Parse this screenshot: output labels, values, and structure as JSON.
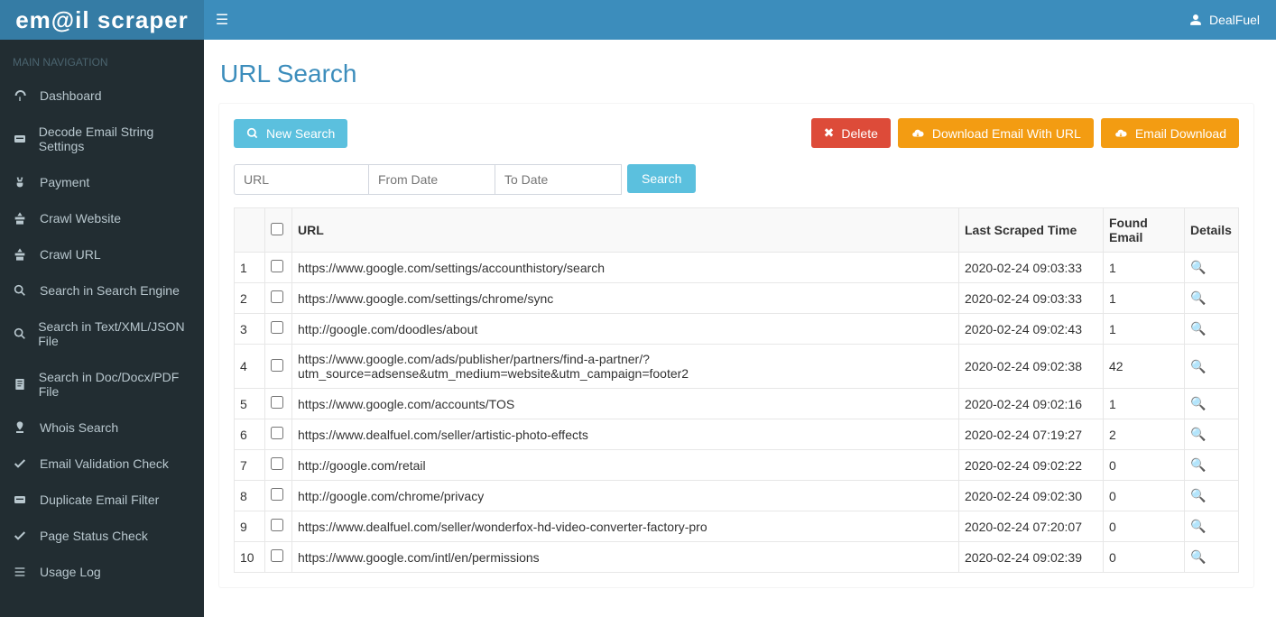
{
  "brand": "em@il scraper",
  "user_name": "DealFuel",
  "sidebar": {
    "header": "MAIN NAVIGATION",
    "items": [
      {
        "label": "Dashboard"
      },
      {
        "label": "Decode Email String Settings"
      },
      {
        "label": "Payment"
      },
      {
        "label": "Crawl Website"
      },
      {
        "label": "Crawl URL"
      },
      {
        "label": "Search in Search Engine"
      },
      {
        "label": "Search in Text/XML/JSON File"
      },
      {
        "label": "Search in Doc/Docx/PDF File"
      },
      {
        "label": "Whois Search"
      },
      {
        "label": "Email Validation Check"
      },
      {
        "label": "Duplicate Email Filter"
      },
      {
        "label": "Page Status Check"
      },
      {
        "label": "Usage Log"
      }
    ]
  },
  "page": {
    "title": "URL Search",
    "new_search_label": "New Search",
    "delete_label": "Delete",
    "download_with_url_label": "Download Email With URL",
    "email_download_label": "Email Download",
    "url_placeholder": "URL",
    "from_date_placeholder": "From Date",
    "to_date_placeholder": "To Date",
    "search_button_label": "Search"
  },
  "table": {
    "headers": {
      "url": "URL",
      "last_scraped": "Last Scraped Time",
      "found_email": "Found Email",
      "details": "Details"
    },
    "rows": [
      {
        "n": "1",
        "url": "https://www.google.com/settings/accounthistory/search",
        "time": "2020-02-24 09:03:33",
        "found": "1"
      },
      {
        "n": "2",
        "url": "https://www.google.com/settings/chrome/sync",
        "time": "2020-02-24 09:03:33",
        "found": "1"
      },
      {
        "n": "3",
        "url": "http://google.com/doodles/about",
        "time": "2020-02-24 09:02:43",
        "found": "1"
      },
      {
        "n": "4",
        "url": "https://www.google.com/ads/publisher/partners/find-a-partner/?utm_source=adsense&utm_medium=website&utm_campaign=footer2",
        "time": "2020-02-24 09:02:38",
        "found": "42"
      },
      {
        "n": "5",
        "url": "https://www.google.com/accounts/TOS",
        "time": "2020-02-24 09:02:16",
        "found": "1"
      },
      {
        "n": "6",
        "url": "https://www.dealfuel.com/seller/artistic-photo-effects",
        "time": "2020-02-24 07:19:27",
        "found": "2"
      },
      {
        "n": "7",
        "url": "http://google.com/retail",
        "time": "2020-02-24 09:02:22",
        "found": "0"
      },
      {
        "n": "8",
        "url": "http://google.com/chrome/privacy",
        "time": "2020-02-24 09:02:30",
        "found": "0"
      },
      {
        "n": "9",
        "url": "https://www.dealfuel.com/seller/wonderfox-hd-video-converter-factory-pro",
        "time": "2020-02-24 07:20:07",
        "found": "0"
      },
      {
        "n": "10",
        "url": "https://www.google.com/intl/en/permissions",
        "time": "2020-02-24 09:02:39",
        "found": "0"
      }
    ]
  }
}
